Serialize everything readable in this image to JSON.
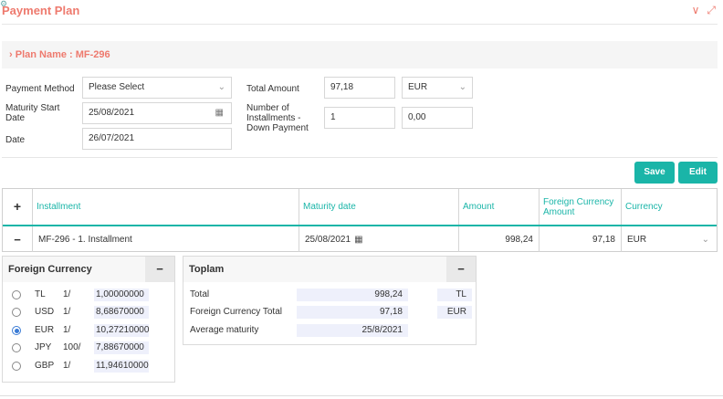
{
  "header": {
    "title": "Payment Plan",
    "plan_name": "Plan Name : MF-296"
  },
  "form": {
    "payment_method_label": "Payment Method",
    "payment_method_value": "Please Select",
    "maturity_start_label": "Maturity Start Date",
    "maturity_start_value": "25/08/2021",
    "date_label": "Date",
    "date_value": "26/07/2021",
    "total_amount_label": "Total Amount",
    "total_amount_value": "97,18",
    "currency_value": "EUR",
    "installments_label": "Number of Installments - Down Payment",
    "installments_value": "1",
    "down_payment_value": "0,00"
  },
  "buttons": {
    "save": "Save",
    "edit": "Edit"
  },
  "table": {
    "add_symbol": "+",
    "headers": {
      "installment": "Installment",
      "maturity": "Maturity date",
      "amount": "Amount",
      "foreign": "Foreign Currency Amount",
      "currency": "Currency"
    },
    "row": {
      "remove_symbol": "−",
      "installment": "MF-296 - 1. Installment",
      "maturity": "25/08/2021",
      "amount": "998,24",
      "foreign": "97,18",
      "currency": "EUR"
    }
  },
  "foreign_currency": {
    "title": "Foreign Currency",
    "minimize": "−",
    "selected": "EUR",
    "rows": [
      {
        "code": "TL",
        "unit": "1/",
        "rate": "1,00000000"
      },
      {
        "code": "USD",
        "unit": "1/",
        "rate": "8,68670000"
      },
      {
        "code": "EUR",
        "unit": "1/",
        "rate": "10,27210000"
      },
      {
        "code": "JPY",
        "unit": "100/",
        "rate": "7,88670000"
      },
      {
        "code": "GBP",
        "unit": "1/",
        "rate": "11,94610000"
      }
    ]
  },
  "toplam": {
    "title": "Toplam",
    "minimize": "−",
    "rows": [
      {
        "label": "Total",
        "value": "998,24",
        "unit": "TL"
      },
      {
        "label": "Foreign Currency Total",
        "value": "97,18",
        "unit": "EUR"
      },
      {
        "label": "Average maturity",
        "value": "25/8/2021",
        "unit": ""
      }
    ]
  },
  "colors": {
    "accent": "#1ab5a8",
    "title": "#ee7a6e"
  },
  "icons": {
    "settings": "⚙",
    "collapse": "∨",
    "expand": "⤢",
    "chevron_right": "›",
    "chevron_down": "⌄",
    "calendar": "📅"
  }
}
